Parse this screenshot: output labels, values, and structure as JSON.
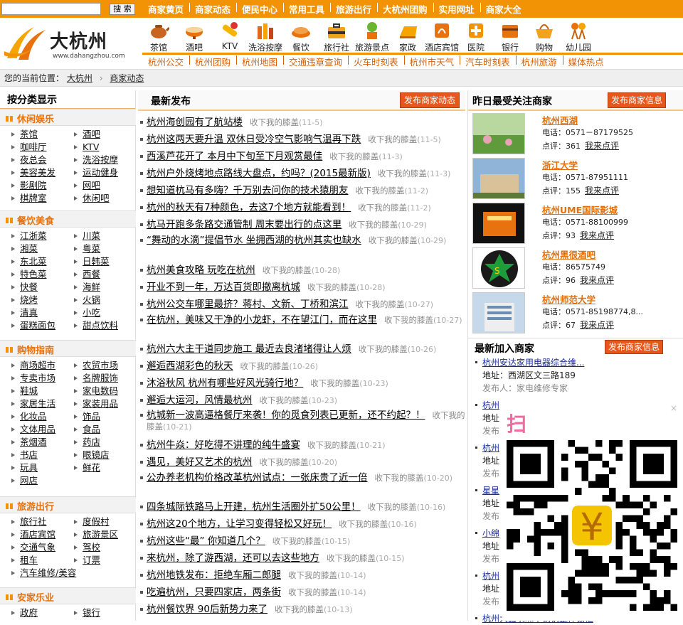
{
  "topbar": {
    "search_button": "搜 索",
    "nav": [
      "商家黄页",
      "商家动态",
      "便民中心",
      "常用工具",
      "旅游出行",
      "大杭州团购",
      "实用网址",
      "商家大全"
    ]
  },
  "logo": {
    "text": "大杭州",
    "url": "www.dahangzhou.com"
  },
  "categories": [
    "茶馆",
    "酒吧",
    "KTV",
    "洗浴按摩",
    "餐饮",
    "旅行社",
    "旅游景点",
    "家政",
    "酒店宾馆",
    "医院",
    "银行",
    "购物",
    "幼儿园"
  ],
  "subnav": [
    "杭州公交",
    "杭州团购",
    "杭州地图",
    "交通违章查询",
    "火车时刻表",
    "杭州市天气",
    "汽车时刻表",
    "杭州旅游",
    "媒体热点"
  ],
  "breadcrumb": {
    "prefix": "您的当前位置：",
    "home": "大杭州",
    "current": "商家动态"
  },
  "left": {
    "title": "按分类显示",
    "sections": [
      {
        "title": "休闲娱乐",
        "items": [
          "茶馆",
          "酒吧",
          "咖啡厅",
          "KTV",
          "夜总会",
          "洗浴按摩",
          "美容美发",
          "运动健身",
          "影剧院",
          "网吧",
          "棋牌室",
          "休闲吧"
        ]
      },
      {
        "title": "餐饮美食",
        "items": [
          "江浙菜",
          "川菜",
          "湘菜",
          "粤菜",
          "东北菜",
          "日韩菜",
          "特色菜",
          "西餐",
          "快餐",
          "海鲜",
          "烧烤",
          "火锅",
          "清真",
          "小吃",
          "蛋糕面包",
          "甜点饮料"
        ]
      },
      {
        "title": "购物指南",
        "items": [
          "商场超市",
          "农贸市场",
          "专卖市场",
          "名牌服饰",
          "鞋城",
          "家电数码",
          "家居生活",
          "家装用品",
          "化妆品",
          "饰品",
          "文体用品",
          "食品",
          "茶烟酒",
          "药店",
          "书店",
          "眼镜店",
          "玩具",
          "鲜花",
          "网店"
        ]
      },
      {
        "title": "旅游出行",
        "items": [
          "旅行社",
          "度假村",
          "酒店宾馆",
          "旅游景区",
          "交通气象",
          "驾校",
          "租车",
          "订票",
          "汽车维修/美容"
        ]
      },
      {
        "title": "安家乐业",
        "items": [
          "政府",
          "银行"
        ]
      }
    ]
  },
  "middle": {
    "title": "最新发布",
    "publish_button": "发布商家动态",
    "author": "收下我的膝盖",
    "news": [
      {
        "title": "杭州海创园有了航站楼",
        "date": "(11-5)"
      },
      {
        "title": "杭州这两天要升温 双休日受冷空气影响气温再下跌",
        "date": "(11-5)"
      },
      {
        "title": "西溪芦花开了 本月中下旬至下月观赏最佳",
        "date": "(11-3)"
      },
      {
        "title": "杭州户外烧烤地点路线大盘点，约吗？(2015最新版)",
        "date": "(11-3)"
      },
      {
        "title": "想知道杭马有多嗨？千万别去问你的技术猿朋友",
        "date": "(11-2)"
      },
      {
        "title": "杭州的秋天有7种颜色，去这7个地方就能看到！",
        "date": "(11-2)"
      },
      {
        "title": "杭马开跑多条路交通管制 周末要出行的点这里",
        "date": "(10-29)"
      },
      {
        "title": "“舞动的水滴”提倡节水 坐拥西湖的杭州其实也缺水",
        "date": "(10-29)"
      },
      {
        "title": "杭州美食攻略 玩吃在杭州",
        "date": "(10-28)"
      },
      {
        "title": "开业不到一年，万达百货即撤离杭城",
        "date": "(10-28)"
      },
      {
        "title": "杭州公交车哪里最挤？蒋村、文新、丁桥和滨江",
        "date": "(10-27)"
      },
      {
        "title": "在杭州，美味又干净的小龙虾，不在望江门，而在这里",
        "date": "(10-27)"
      },
      {
        "title": "杭州六大主干道同步施工 最近去良渚堵得让人烦",
        "date": "(10-26)"
      },
      {
        "title": "邂逅西湖彩色的秋天",
        "date": "(10-26)"
      },
      {
        "title": "沐浴秋风 杭州有哪些好风光骑行地？",
        "date": "(10-23)"
      },
      {
        "title": "邂逅大运河，风情最杭州",
        "date": "(10-23)"
      },
      {
        "title": "杭城新一波高逼格餐厅来袭！你的觅食列表已更新，还不约起？！",
        "date": "(10-21)"
      },
      {
        "title": "杭州牛焱：好吃得不讲理的纯牛盛宴",
        "date": "(10-21)"
      },
      {
        "title": "遇见，美好又艺术的杭州",
        "date": "(10-20)"
      },
      {
        "title": "公办养老机构价格改革杭州试点：一张床贵了近一倍",
        "date": "(10-20)"
      },
      {
        "title": "四条城际铁路马上开建，杭州生活圈外扩50公里！",
        "date": "(10-16)"
      },
      {
        "title": "杭州这20个地方，让学习变得轻松又好玩！",
        "date": "(10-16)"
      },
      {
        "title": "杭州这些“最” 你知道几个？",
        "date": "(10-15)"
      },
      {
        "title": "来杭州，除了游西湖，还可以去这些地方",
        "date": "(10-15)"
      },
      {
        "title": "杭州地铁发布：拒绝车厢二郎腿",
        "date": "(10-14)"
      },
      {
        "title": "吃遍杭州，只要四家店，两条街",
        "date": "(10-14)"
      },
      {
        "title": "杭州餐饮界 90后新势力来了",
        "date": "(10-13)"
      }
    ]
  },
  "right": {
    "title": "昨日最受关注商家",
    "publish_button": "发布商家信息",
    "phone_label": "电话：",
    "review_label": "点评：",
    "review_link": "我来点评",
    "businesses": [
      {
        "name": "杭州西湖",
        "phone": "0571－87179525",
        "reviews": "361"
      },
      {
        "name": "浙江大学",
        "phone": "0571-87951111",
        "reviews": "155"
      },
      {
        "name": "杭州UME国际影城",
        "phone": "0571-88100999",
        "reviews": "93"
      },
      {
        "name": "杭州黑很酒吧",
        "phone": "86575749",
        "reviews": "96"
      },
      {
        "name": "杭州师范大学",
        "phone": "0571-85198774,8...",
        "reviews": "67"
      }
    ],
    "new_title": "最新加入商家",
    "new_button": "发布商家信息",
    "new_businesses": [
      {
        "name": "杭州安达家用电器综合维...",
        "address": "地址：西湖区文三路189",
        "publisher": "发布人：家电维修专家"
      },
      {
        "name": "杭州",
        "address": "地址",
        "publisher": "发布"
      },
      {
        "name": "杭州",
        "address": "地址",
        "publisher": "发布"
      },
      {
        "name": "星星",
        "address": "地址",
        "publisher": "发布"
      },
      {
        "name": "小绵",
        "address": "地址",
        "publisher": "发布"
      },
      {
        "name": "杭州",
        "address": "地址",
        "publisher": "发布"
      },
      {
        "name": "杭州大鑫明珠不锈钢整体橱柜",
        "address": "",
        "publisher": ""
      }
    ]
  },
  "qr": {
    "text": "扫"
  }
}
